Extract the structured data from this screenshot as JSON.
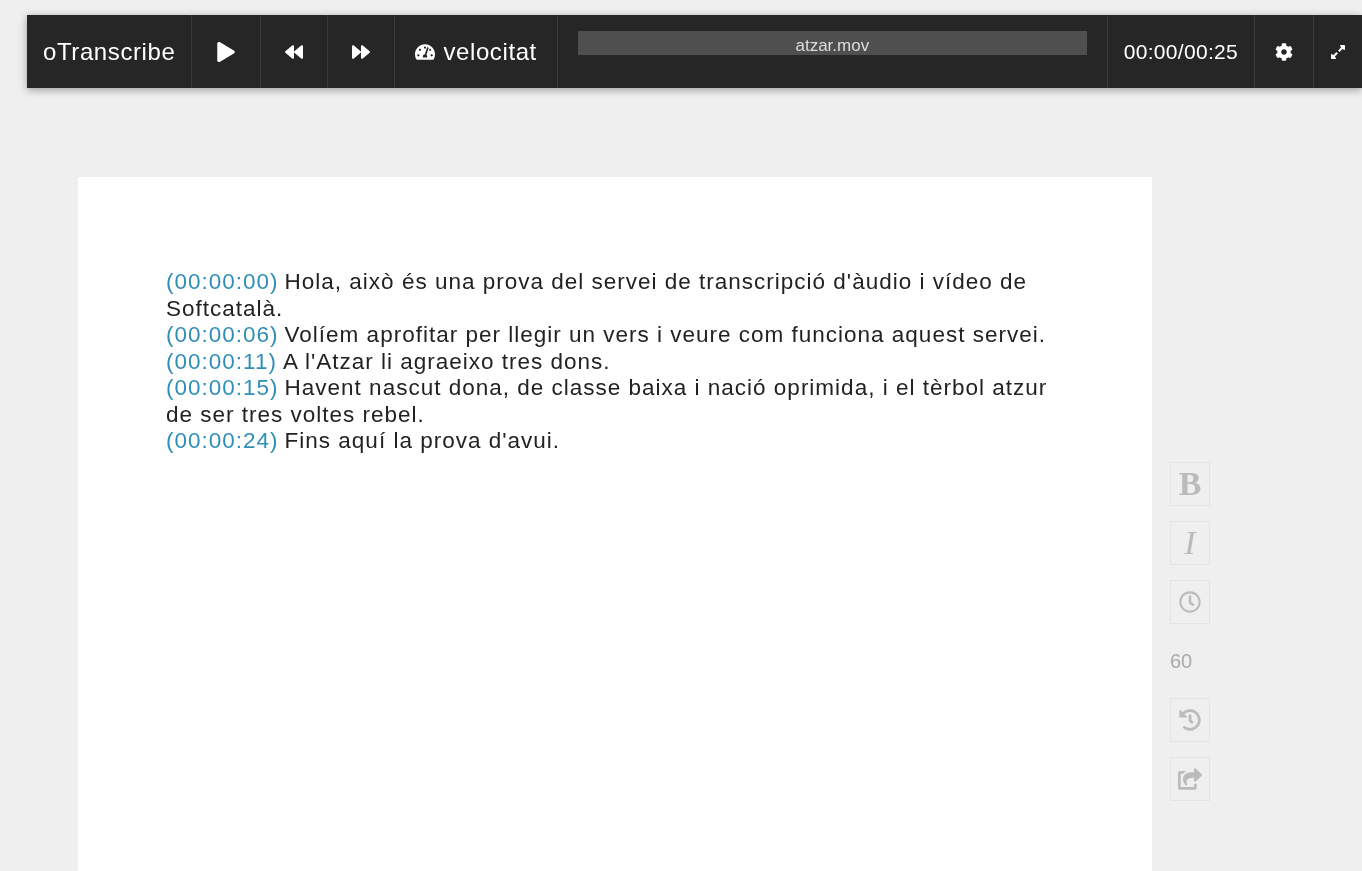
{
  "toolbar": {
    "title": "oTranscribe",
    "speed_label": "velocitat",
    "file_name": "atzar.mov",
    "time": "00:00/00:25"
  },
  "transcript": [
    {
      "timestamp": "(00:00:00)",
      "text": "Hola, això és una prova del servei de transcripció d'àudio i vídeo de Softcatalà."
    },
    {
      "timestamp": "(00:00:06)",
      "text": "Volíem aprofitar per llegir un vers i veure com funciona aquest servei."
    },
    {
      "timestamp": "(00:00:11)",
      "text": "A l'Atzar li agraeixo tres dons."
    },
    {
      "timestamp": "(00:00:15)",
      "text": "Havent nascut dona, de classe baixa i nació oprimida, i el tèrbol atzur de ser tres voltes rebel."
    },
    {
      "timestamp": "(00:00:24)",
      "text": "Fins aquí la prova d'avui."
    }
  ],
  "side_tools": [
    {
      "kind": "bold",
      "label": "B"
    },
    {
      "kind": "italic",
      "label": "I"
    },
    {
      "kind": "clock"
    },
    {
      "kind": "number",
      "label": "60"
    },
    {
      "kind": "rewind"
    },
    {
      "kind": "export"
    }
  ]
}
